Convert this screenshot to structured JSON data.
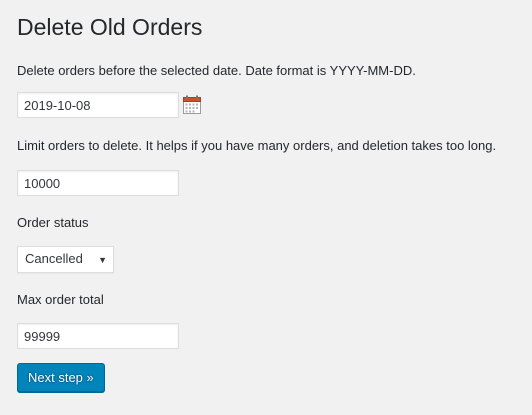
{
  "page": {
    "title": "Delete Old Orders"
  },
  "form": {
    "date_description": "Delete orders before the selected date. Date format is YYYY-MM-DD.",
    "date_value": "2019-10-08",
    "limit_description": "Limit orders to delete. It helps if you have many orders, and deletion takes too long.",
    "limit_value": "10000",
    "status_label": "Order status",
    "status_selected": "Cancelled",
    "max_total_label": "Max order total",
    "max_total_value": "99999",
    "submit_label": "Next step »"
  },
  "icons": {
    "calendar": "calendar-icon",
    "dropdown": "chevron-down-icon"
  },
  "colors": {
    "background": "#f1f1f1",
    "primary_button": "#0085ba",
    "calendar_red": "#d54e21"
  }
}
